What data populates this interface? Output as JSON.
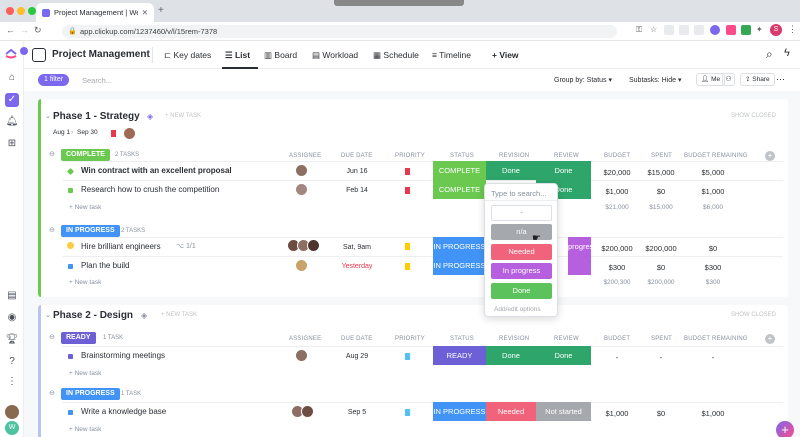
{
  "browser": {
    "tab_title": "Project Management | Webinar",
    "url": "app.clickup.com/1237460/v/l/15rem-7378",
    "profile_initial": "S"
  },
  "header": {
    "title": "Project Management",
    "tabs": [
      "Key dates",
      "List",
      "Board",
      "Workload",
      "Schedule",
      "Timeline",
      "+ View"
    ]
  },
  "toolbar": {
    "filter": "1 filter",
    "search_placeholder": "Search...",
    "group_by": "Group by: Status",
    "subtasks": "Subtasks: Hide",
    "me": "Me",
    "share": "Share"
  },
  "columns": {
    "assignee": "ASSIGNEE",
    "due": "DUE DATE",
    "priority": "PRIORITY",
    "status": "STATUS",
    "revision": "REVISION",
    "review": "REVIEW",
    "budget": "BUDGET",
    "spent": "SPENT",
    "remaining": "BUDGET REMAINING"
  },
  "labels": {
    "new_task_header": "+ NEW TASK",
    "new_task": "+ New task",
    "show_closed": "SHOW CLOSED"
  },
  "phase1": {
    "title": "Phase 1 - Strategy",
    "start": "Aug 1",
    "end": "Sep 30",
    "groups": [
      {
        "status": "COMPLETE",
        "count": "2 TASKS",
        "color": "#6bc950",
        "tasks": [
          {
            "name": "Win contract with an excellent proposal",
            "due": "Jun 16",
            "status": "COMPLETE",
            "revision": "Done",
            "review": "Done",
            "budget": "$20,000",
            "spent": "$15,000",
            "remaining": "$5,000"
          },
          {
            "name": "Research how to crush the competition",
            "due": "Feb 14",
            "status": "COMPLETE",
            "revision": "",
            "review": "Done",
            "budget": "$1,000",
            "spent": "$0",
            "remaining": "$1,000"
          }
        ],
        "totals": {
          "budget": "$21,000",
          "spent": "$15,000",
          "remaining": "$6,000"
        }
      },
      {
        "status": "IN PROGRESS",
        "count": "2 TASKS",
        "color": "#4194f6",
        "tasks": [
          {
            "name": "Hire brilliant engineers",
            "subtasks": "1/1",
            "due": "Sat, 9am",
            "status": "IN PROGRESS",
            "revision": "",
            "review": "progress",
            "budget": "$200,000",
            "spent": "$200,000",
            "remaining": "$0"
          },
          {
            "name": "Plan the build",
            "due": "Yesterday",
            "status": "IN PROGRESS",
            "revision": "",
            "review": "progress",
            "budget": "$300",
            "spent": "$0",
            "remaining": "$300"
          }
        ],
        "totals": {
          "budget": "$200,300",
          "spent": "$200,000",
          "remaining": "$300"
        }
      }
    ]
  },
  "phase2": {
    "title": "Phase 2 - Design",
    "groups": [
      {
        "status": "READY",
        "count": "1 TASK",
        "color": "#6d5fd5",
        "tasks": [
          {
            "name": "Brainstorming meetings",
            "due": "Aug 29",
            "status": "READY",
            "revision": "Done",
            "review": "Done",
            "budget": "-",
            "spent": "-",
            "remaining": "-"
          }
        ]
      },
      {
        "status": "IN PROGRESS",
        "count": "1 TASK",
        "color": "#4194f6",
        "tasks": [
          {
            "name": "Write a knowledge base",
            "due": "Sep 5",
            "status": "IN PROGRESS",
            "revision": "Needed",
            "review": "Not started",
            "budget": "$1,000",
            "spent": "$0",
            "remaining": "$1,000"
          }
        ]
      }
    ]
  },
  "dropdown": {
    "search_placeholder": "Type to search...",
    "blank": "-",
    "options": [
      {
        "label": "n/a",
        "color": "#a5a8ad"
      },
      {
        "label": "Needed",
        "color": "#f1637a"
      },
      {
        "label": "In progress",
        "color": "#b660e0"
      },
      {
        "label": "Done",
        "color": "#5cc25c"
      }
    ],
    "edit": "Add/edit options"
  },
  "colors": {
    "complete": "#6bc950",
    "done": "#2ea56a",
    "in_progress": "#4194f6",
    "purple": "#b660e0",
    "ready": "#6d5fd5",
    "needed": "#f1637a",
    "not_started": "#a5a8ad"
  }
}
